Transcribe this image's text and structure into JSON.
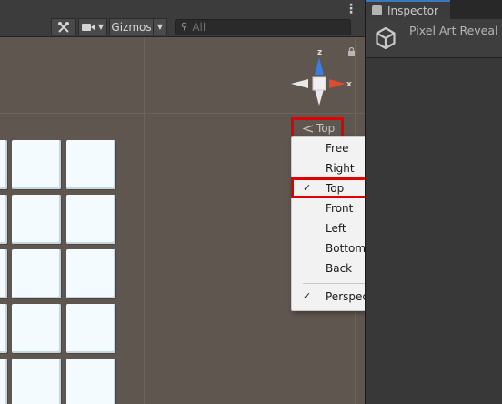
{
  "scene_toolbar": {
    "more_icon": "kebab-icon",
    "tools_icon": "tools-icon",
    "camera_icon": "camera-icon",
    "gizmos_label": "Gizmos",
    "search_placeholder": "All"
  },
  "scene_view": {
    "gizmo_labels": {
      "y_axis": "z",
      "x_axis": "x"
    },
    "view_label": "Top",
    "colors": {
      "x_axis": "#e04a2f",
      "z_axis": "#3c7de2",
      "background": "#5f564f",
      "tile": "#f3fbff"
    }
  },
  "view_menu": {
    "items": [
      {
        "label": "Free",
        "checked": false
      },
      {
        "label": "Right",
        "checked": false
      },
      {
        "label": "Top",
        "checked": true
      },
      {
        "label": "Front",
        "checked": false
      },
      {
        "label": "Left",
        "checked": false
      },
      {
        "label": "Bottom",
        "checked": false
      },
      {
        "label": "Back",
        "checked": false
      },
      {
        "label": "Perspective",
        "checked": true
      }
    ],
    "check_glyph": "✓"
  },
  "inspector": {
    "tab_label": "Inspector",
    "object_title": "Pixel Art Reveal",
    "accent_color": "#3a79bb"
  },
  "highlights": {
    "color": "#e00000"
  }
}
